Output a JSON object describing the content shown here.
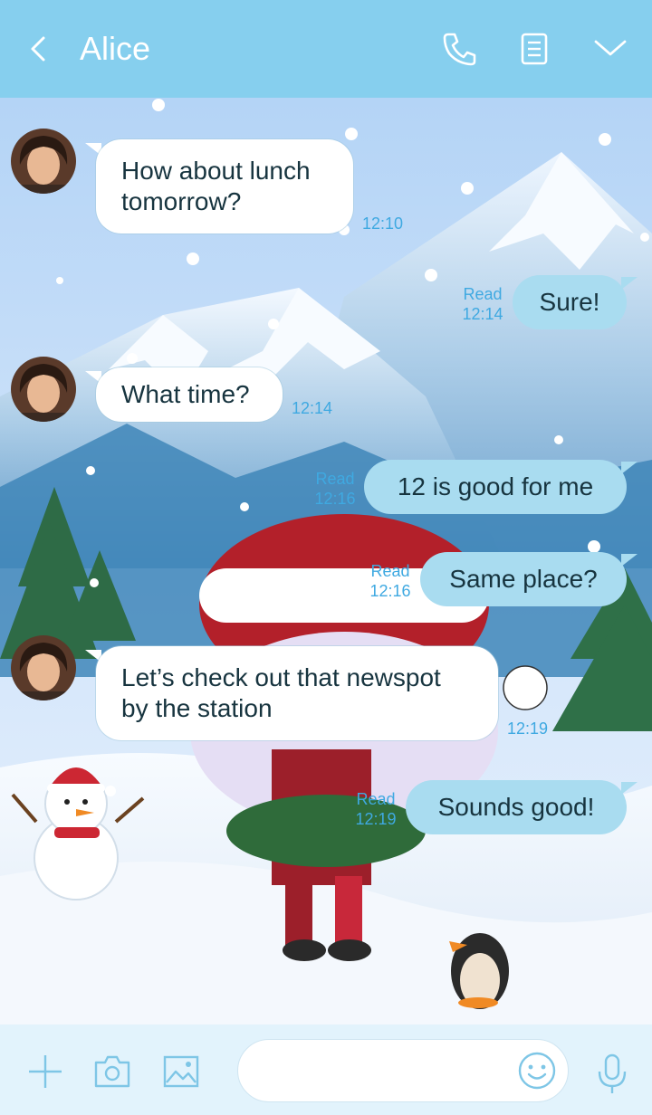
{
  "header": {
    "title": "Alice",
    "icons": [
      "back-icon",
      "phone-icon",
      "notes-icon",
      "chevron-down-icon"
    ],
    "color": "#86cfee"
  },
  "messages": [
    {
      "direction": "in",
      "lines": [
        "How about lunch",
        "tomorrow?"
      ],
      "time": "12:10"
    },
    {
      "direction": "out",
      "text": "Sure!",
      "read": "Read",
      "time": "12:14"
    },
    {
      "direction": "in",
      "text": "What time?",
      "time": "12:14"
    },
    {
      "direction": "out",
      "text": "12 is good for me",
      "read": "Read",
      "time": "12:16"
    },
    {
      "direction": "out",
      "text": "Same place?",
      "read": "Read",
      "time": "12:16"
    },
    {
      "direction": "in",
      "lines": [
        "Let’s check out that newspot",
        "by the station"
      ],
      "time": "12:19"
    },
    {
      "direction": "out",
      "text": "Sounds good!",
      "read": "Read",
      "time": "12:19"
    }
  ],
  "composer": {
    "placeholder": "",
    "icons": [
      "plus-icon",
      "camera-icon",
      "image-icon",
      "emoji-icon",
      "microphone-icon"
    ]
  },
  "colors": {
    "accent": "#86cfee",
    "outgoing_bubble": "#a9dcf0",
    "timestamp": "#3fa9e1"
  }
}
